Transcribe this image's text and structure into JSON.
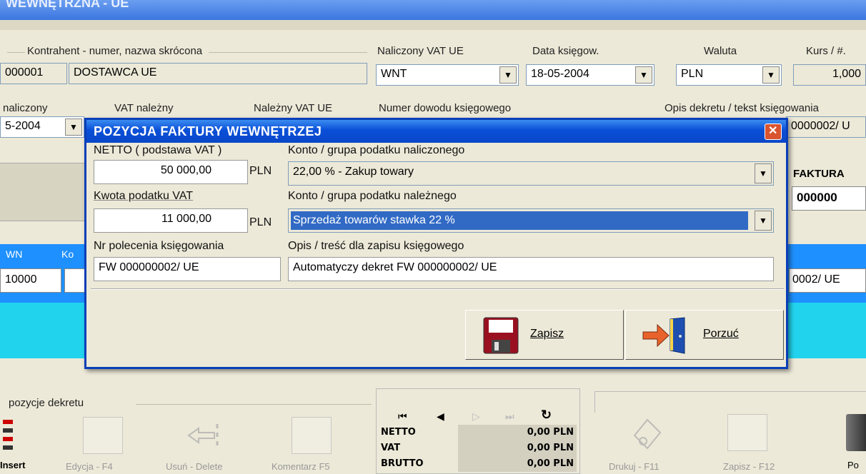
{
  "window": {
    "title": "WEWNĘTRZNA - UE"
  },
  "header": {
    "contractor_label": "Kontrahent - numer, nazwa skrócona",
    "contractor_number": "000001",
    "contractor_name": "DOSTAWCA UE",
    "vat_label": "Naliczony VAT UE",
    "vat_value": "WNT",
    "date_label": "Data księgow.",
    "date_value": "18-05-2004",
    "currency_label": "Waluta",
    "currency_value": "PLN",
    "rate_label": "Kurs / #.",
    "rate_value": "1,000"
  },
  "row2": {
    "label1": "naliczony",
    "label2": "VAT należny",
    "label3": "Należny VAT UE",
    "label4": "Numer dowodu księgowego",
    "label5": "Opis dekretu / tekst księgowania",
    "date_value": "5-2004",
    "doc_value": "0000002/ U"
  },
  "right_panel": {
    "label": "FAKTURA",
    "value": "000000"
  },
  "band": {
    "col1": "WN",
    "col2": "Ko",
    "value1": "10000",
    "value2": "0002/ UE"
  },
  "dialog": {
    "title": "POZYCJA FAKTURY WEWNĘTRZEJ",
    "netto_label": "NETTO ( podstawa VAT )",
    "netto_value": "50 000,00",
    "netto_currency": "PLN",
    "account_input_label": "Konto / grupa podatku naliczonego",
    "account_input_value": "22,00 % -  Zakup towary",
    "vat_amount_label": "Kwota podatku VAT",
    "vat_amount_value": "11 000,00",
    "vat_amount_currency": "PLN",
    "account_output_label": "Konto / grupa podatku należnego",
    "account_output_value": "Sprzedaż towarów stawka 22 %",
    "order_label": "Nr polecenia księgowania",
    "order_value": "FW 000000002/ UE",
    "desc_label": "Opis / treść dla zapisu księgowego",
    "desc_value": "Automatyczy dekret FW 000000002/ UE",
    "save_label": "Zapisz",
    "cancel_label": "Porzuć"
  },
  "bottom": {
    "section_label": "pozycje dekretu",
    "toolbar": [
      "Insert",
      "Edycja - F4",
      "Usuń - Delete",
      "Komentarz F5"
    ],
    "summary": [
      {
        "label": "NETTO",
        "value": "0,00 PLN"
      },
      {
        "label": "VAT",
        "value": "0,00 PLN"
      },
      {
        "label": "BRUTTO",
        "value": "0,00 PLN"
      }
    ],
    "right_toolbar": [
      "Drukuj - F11",
      "Zapisz - F12",
      "Po"
    ]
  },
  "colors": {
    "titlebar": "#0a4fd8",
    "band": "#1e90ff",
    "cyan": "#22d3ee",
    "highlight": "#316ac5"
  }
}
